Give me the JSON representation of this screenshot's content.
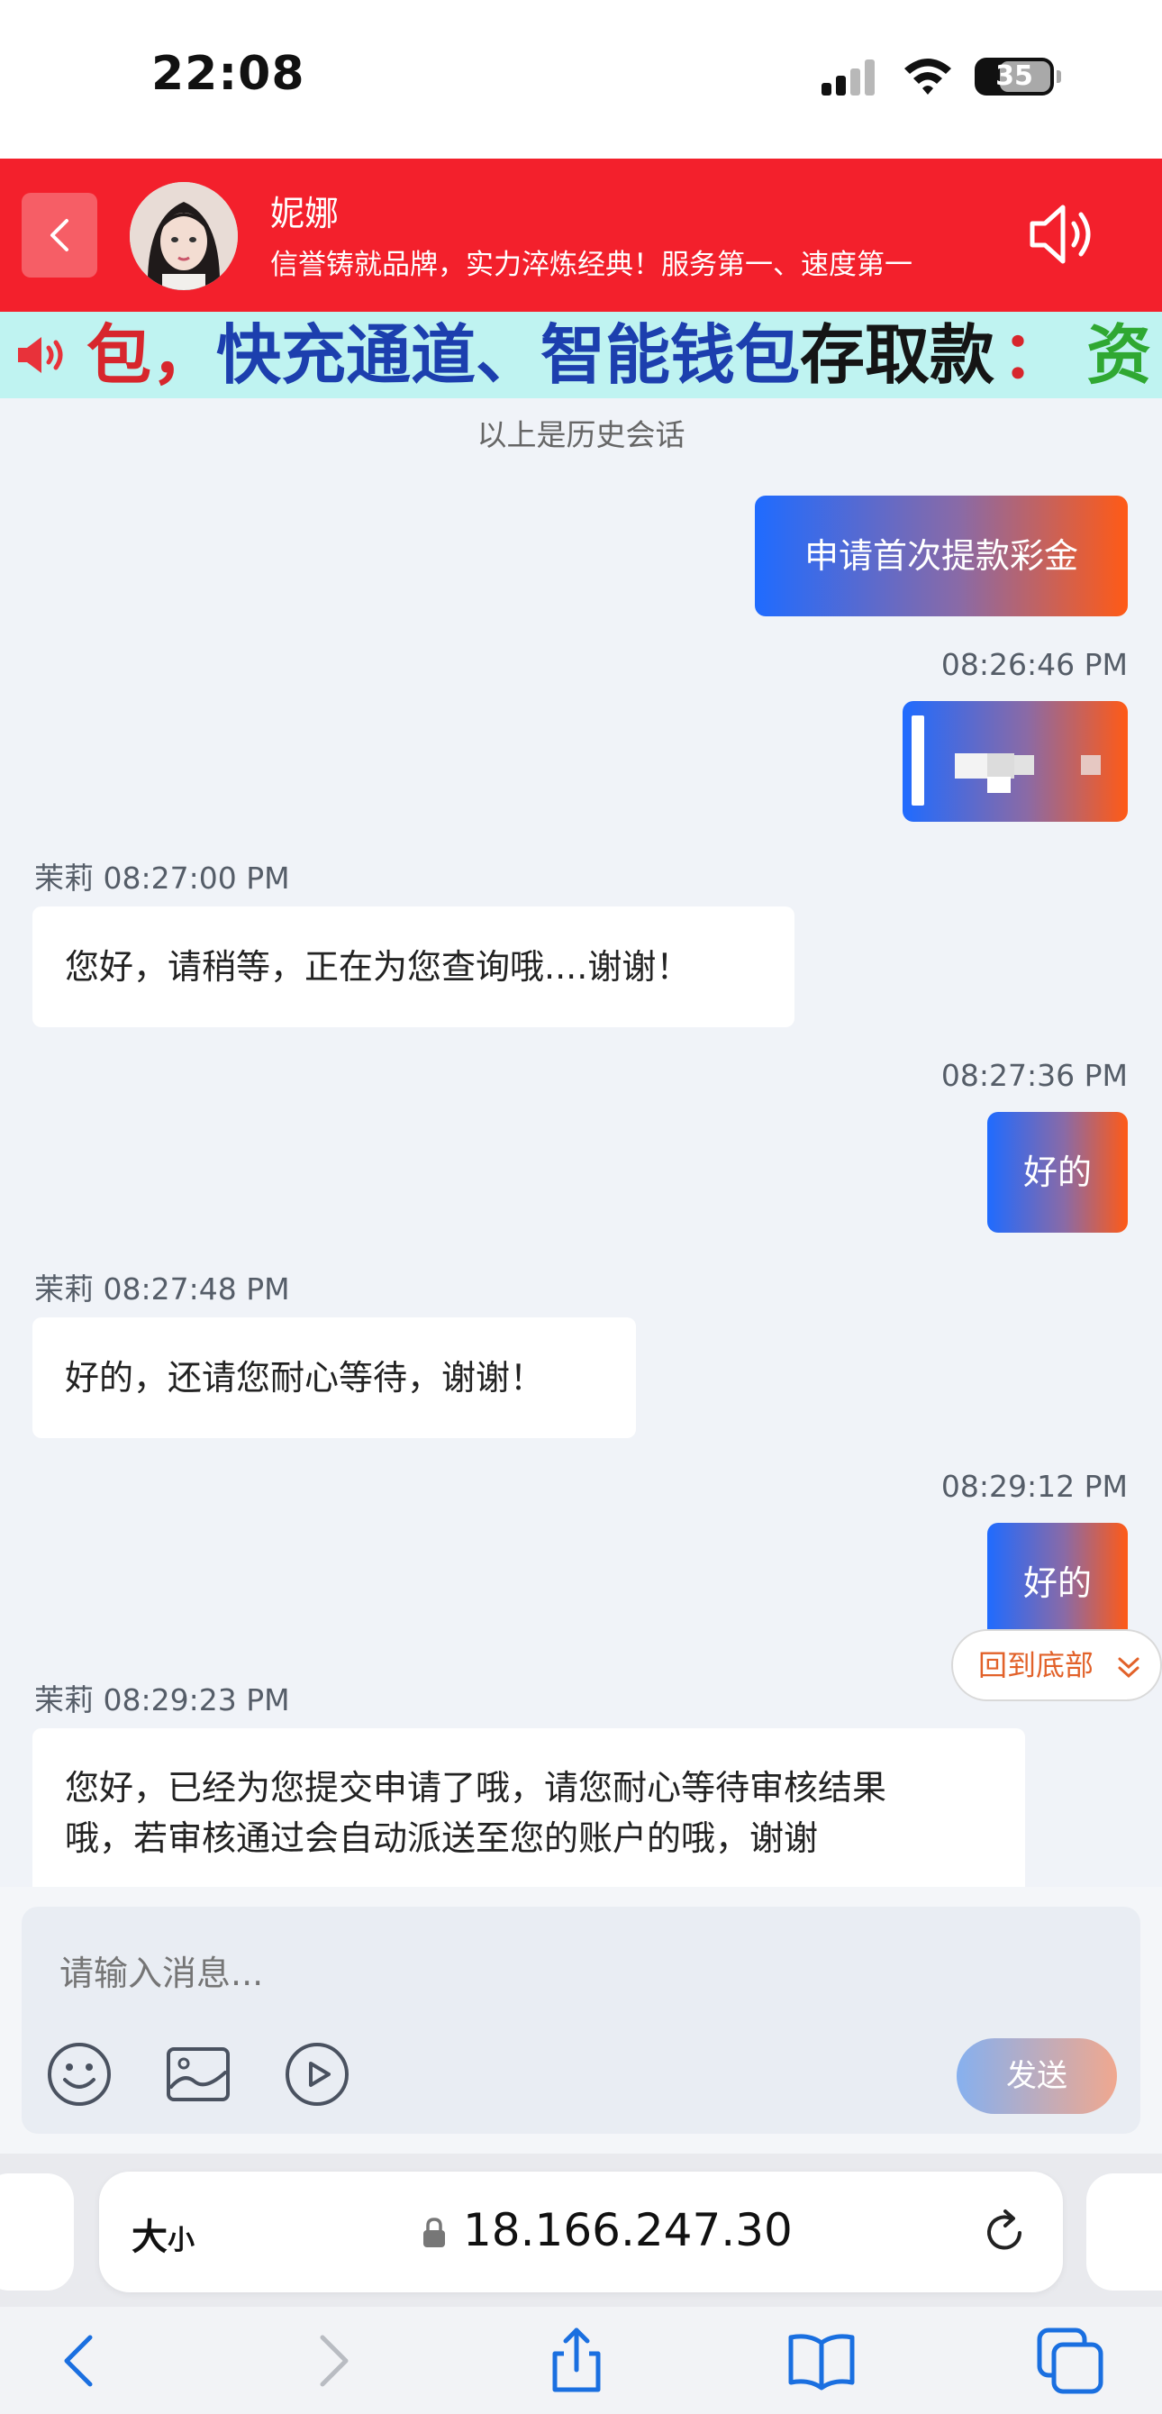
{
  "status_bar": {
    "time": "22:08",
    "battery": "35"
  },
  "header": {
    "agent_name": "妮娜",
    "tagline": "信誉铸就品牌，实力淬炼经典！服务第一、速度第一"
  },
  "marquee": {
    "segments": [
      {
        "text": "包，",
        "color": "#d7262c"
      },
      {
        "text": "快充通道、智能钱包",
        "color": "#1c3fae"
      },
      {
        "text": "存取款",
        "color": "#151515"
      },
      {
        "text": "：",
        "color": "#d7262c"
      },
      {
        "text": "资",
        "color": "#2fa832"
      }
    ]
  },
  "history_note": "以上是历史会话",
  "messages": [
    {
      "direction": "out",
      "time": "",
      "text": "申请首次提款彩金"
    },
    {
      "direction": "out",
      "time": "08:26:46 PM",
      "text": "",
      "image": true
    },
    {
      "direction": "in",
      "sender": "茉莉",
      "time": "08:27:00 PM",
      "text": "您好，请稍等，正在为您查询哦....谢谢！"
    },
    {
      "direction": "out",
      "time": "08:27:36 PM",
      "text": "好的"
    },
    {
      "direction": "in",
      "sender": "茉莉",
      "time": "08:27:48 PM",
      "text": "好的，还请您耐心等待，谢谢！"
    },
    {
      "direction": "out",
      "time": "08:29:12 PM",
      "text": "好的"
    },
    {
      "direction": "in",
      "sender": "茉莉",
      "time": "08:29:23 PM",
      "lines": [
        "您好，已经为您提交申请了哦，请您耐心等待审核结果",
        "哦，若审核通过会自动派送至您的账户的哦，谢谢"
      ]
    }
  ],
  "scroll_to_bottom": "回到底部",
  "composer": {
    "placeholder": "请输入消息...",
    "send_label": "发送",
    "tools": [
      "emoji-icon",
      "image-icon",
      "video-icon"
    ]
  },
  "browser": {
    "text_size_label": "大",
    "text_size_small": "小",
    "url": "18.166.247.30"
  },
  "colors": {
    "header_bg": "#f3202c",
    "marquee_bg": "#bff3f1",
    "outgoing_gradient_start": "#1f6bff",
    "outgoing_gradient_end": "#ff5a16",
    "link_orange": "#e2622a",
    "ios_blue": "#1a6fe0"
  }
}
